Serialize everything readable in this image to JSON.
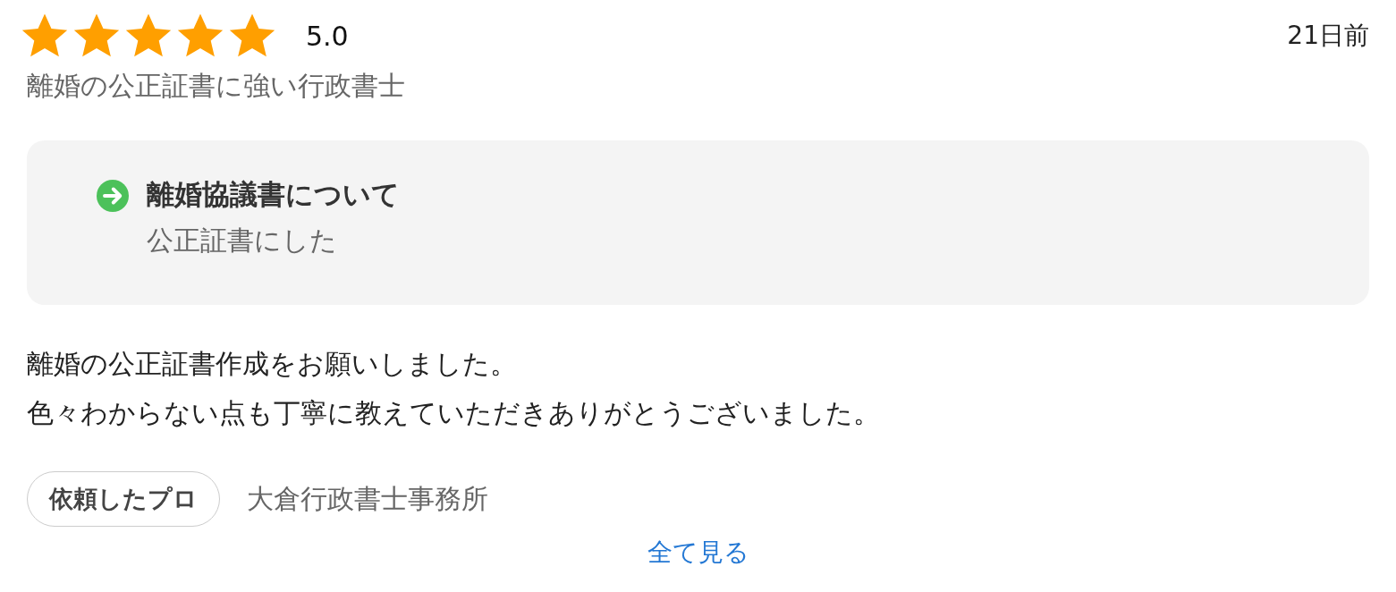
{
  "review": {
    "stars": 5,
    "rating": "5.0",
    "time": "21日前",
    "service": "離婚の公正証書に強い行政書士"
  },
  "request": {
    "title": "離婚協議書について",
    "detail": "公正証書にした"
  },
  "body": [
    "離婚の公正証書作成をお願いしました。",
    "色々わからない点も丁寧に教えていただきありがとうございました。"
  ],
  "pro": {
    "label": "依頼したプロ",
    "name": "大倉行政書士事務所"
  },
  "link": "全て見る"
}
